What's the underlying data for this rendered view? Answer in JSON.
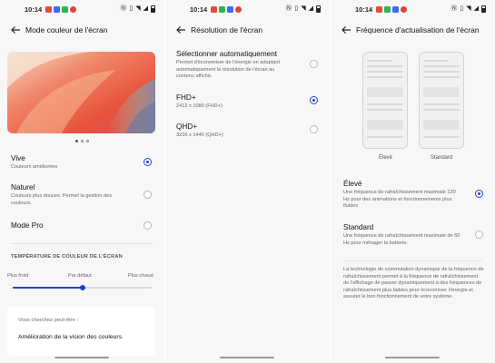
{
  "status_bar": {
    "time": "10:14",
    "app_icon_colors": [
      "#e24a3b",
      "#3a6ee8",
      "#2fb35a",
      "#e0433a"
    ],
    "right_icons": [
      "nfc-icon",
      "vibrate-icon",
      "wifi-icon",
      "signal-icon",
      "battery-icon"
    ]
  },
  "screen1": {
    "title": "Mode couleur de l'écran",
    "options": [
      {
        "title": "Vive",
        "subtitle": "Couleurs améliorées",
        "selected": true
      },
      {
        "title": "Naturel",
        "subtitle": "Couleurs plus douces. Permet la gestion des couleurs.",
        "selected": false
      },
      {
        "title": "Mode Pro",
        "subtitle": "",
        "selected": false
      }
    ],
    "section_label": "TEMPÉRATURE DE COULEUR DE L'ÉCRAN",
    "slider": {
      "left_label": "Plus froid",
      "center_label": "Par défaut",
      "right_label": "Plus chaud",
      "value_fraction": 0.5
    },
    "suggest_card": {
      "subtitle": "Vous cherchez peut-être :",
      "link": "Amélioration de la vision des couleurs"
    },
    "pager": {
      "pages": 3,
      "current": 1
    }
  },
  "screen2": {
    "title": "Résolution de l'écran",
    "options": [
      {
        "title": "Sélectionner automatiquement",
        "subtitle": "Permet d'économiser de l'énergie en adaptant automatiquement la résolution de l'écran au contenu affiché.",
        "selected": false
      },
      {
        "title": "FHD+",
        "subtitle": "2412 x 1080 (FHD+)",
        "selected": true
      },
      {
        "title": "QHD+",
        "subtitle": "3216 x 1440 (QHD+)",
        "selected": false
      }
    ]
  },
  "screen3": {
    "title": "Fréquence d'actualisation de l'écran",
    "preview_labels": [
      "Élevé",
      "Standard"
    ],
    "options": [
      {
        "title": "Élevé",
        "subtitle": "Une fréquence de rafraîchissement maximale 120 Hz pour des animations et fonctionnements plus fluides",
        "selected": true
      },
      {
        "title": "Standard",
        "subtitle": "Une fréquence de rafraîchissement maximale de 60 Hz pour ménager la batterie.",
        "selected": false
      }
    ],
    "footnote": "La technologie de commutation dynamique de la fréquence de rafraîchissement permet à la fréquence de rafraîchissement de l'affichage de passer dynamiquement à des fréquences de rafraîchissement plus faibles pour économiser l'énergie et assurer le bon fonctionnement de votre système."
  },
  "colors": {
    "accent": "#1f3fcb",
    "background": "#f7f7f8"
  }
}
